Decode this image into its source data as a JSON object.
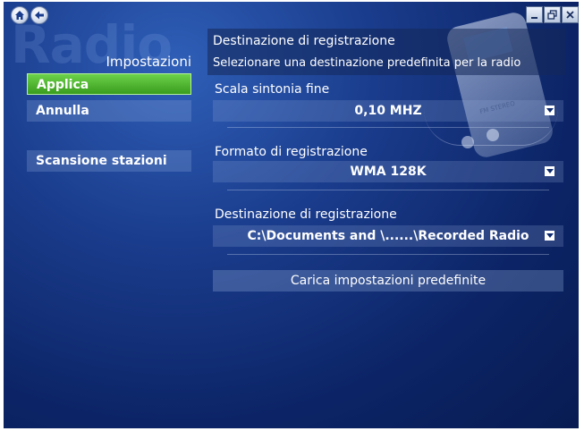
{
  "watermark": "Radio",
  "sidebar": {
    "title": "Impostazioni",
    "apply_label": "Applica",
    "cancel_label": "Annulla",
    "scan_label": "Scansione stazioni"
  },
  "info": {
    "title": "Destinazione di registrazione",
    "subtitle": "Selezionare una destinazione predefinita per la radio"
  },
  "fields": {
    "tuning": {
      "label": "Scala sintonia fine",
      "value": "0,10 MHZ"
    },
    "format": {
      "label": "Formato di registrazione",
      "value": "WMA 128K"
    },
    "destination": {
      "label": "Destinazione di registrazione",
      "value": "C:\\Documents and \\......\\Recorded Radio"
    }
  },
  "defaults_button": "Carica impostazioni predefinite",
  "device_label": "FM STEREO",
  "colors": {
    "accent_green": "#4cb52a",
    "background_blue": "#1a3c8c"
  },
  "icons": {
    "home": "home-icon",
    "back": "back-icon",
    "minimize": "minimize-icon",
    "restore": "restore-icon",
    "close": "close-icon",
    "dropdown": "chevron-down-icon"
  }
}
